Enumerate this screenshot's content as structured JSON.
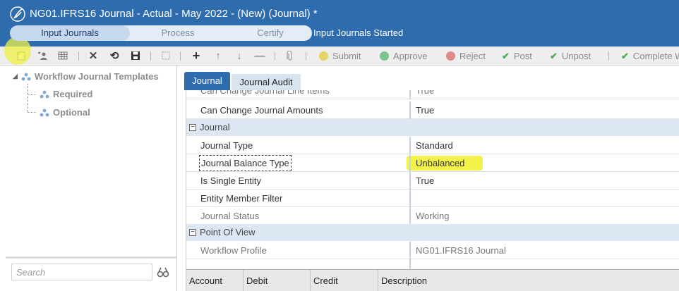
{
  "window": {
    "title": "NG01.IFRS16 Journal  -  Actual  -  May 2022 - (New) (Journal) *",
    "workflow_steps": [
      "Input Journals",
      "Process",
      "Certify"
    ],
    "workflow_status": "Input Journals Started"
  },
  "toolbar": {
    "actions": {
      "submit": "Submit",
      "approve": "Approve",
      "reject": "Reject",
      "post": "Post",
      "unpost": "Unpost",
      "complete": "Complete W"
    },
    "colors": {
      "submit": "#e8d26a",
      "approve": "#7cc38d",
      "reject": "#e08a8a",
      "post": "#4caf50"
    }
  },
  "left_panel": {
    "tree": {
      "root": "Workflow Journal Templates",
      "children": [
        "Required",
        "Optional"
      ]
    },
    "search_placeholder": "Search"
  },
  "tabs": [
    "Journal",
    "Journal Audit"
  ],
  "properties": {
    "rows_top": [
      {
        "name": "Can Change Journal Line Items",
        "value": "True"
      },
      {
        "name": "Can Change Journal Amounts",
        "value": "True"
      }
    ],
    "sections": [
      {
        "title": "Journal",
        "rows": [
          {
            "name": "Journal Type",
            "value": "Standard"
          },
          {
            "name": "Journal Balance Type",
            "value": "Unbalanced"
          },
          {
            "name": "Is Single Entity",
            "value": "True"
          },
          {
            "name": "Entity Member Filter",
            "value": ""
          },
          {
            "name": "Journal Status",
            "value": "Working"
          }
        ]
      },
      {
        "title": "Point Of View",
        "rows": [
          {
            "name": "Workflow Profile",
            "value": "NG01.IFRS16 Journal"
          }
        ]
      }
    ]
  },
  "lines_table": {
    "columns": [
      "Account",
      "Debit",
      "Credit",
      "Description"
    ]
  },
  "colors": {
    "header_blue": "#2f6cae",
    "highlight_yellow": "#f2f24a",
    "section_band": "#dde6f3"
  }
}
